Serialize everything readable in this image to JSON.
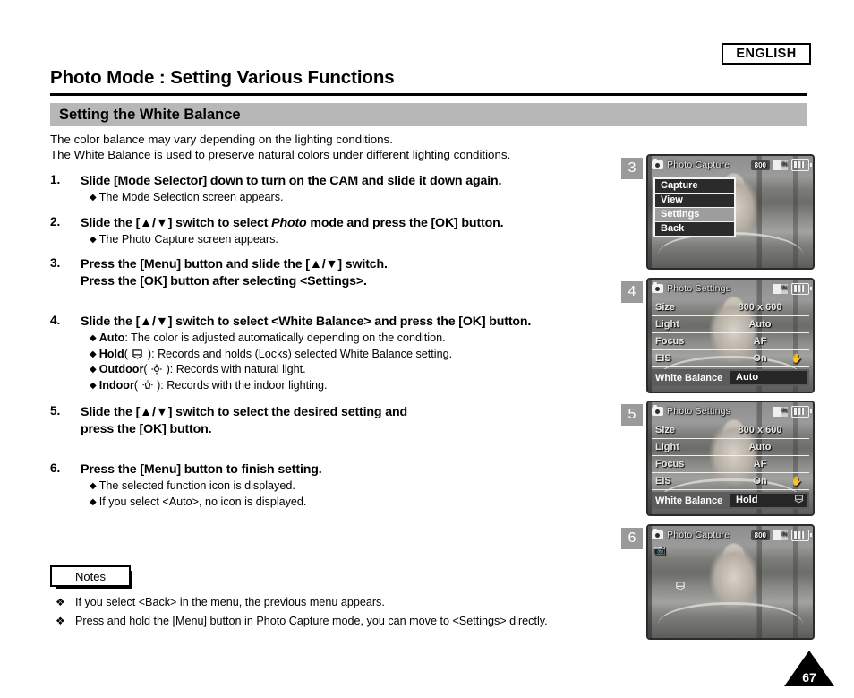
{
  "header": {
    "language_badge": "ENGLISH",
    "page_title": "Photo Mode : Setting Various Functions",
    "section_title": "Setting the White Balance"
  },
  "intro": {
    "line1": "The color balance may vary depending on the lighting conditions.",
    "line2": "The White Balance is used to preserve natural colors under different lighting conditions."
  },
  "steps": [
    {
      "num": "1.",
      "head": "Slide [Mode Selector] down to turn on the CAM and slide it down again.",
      "subs": [
        "The Mode Selection screen appears."
      ]
    },
    {
      "num": "2.",
      "head_pre": "Slide the [▲/▼] switch to select ",
      "head_ital": "Photo",
      "head_post": " mode and press the [OK] button.",
      "subs": [
        "The Photo Capture screen appears."
      ]
    },
    {
      "num": "3.",
      "head_line1": "Press the [Menu] button and slide the [▲/▼] switch.",
      "head_line2": "Press the [OK] button after selecting <Settings>."
    },
    {
      "num": "4.",
      "head": "Slide the [▲/▼] switch to select <White Balance> and press the [OK] button.",
      "options": [
        {
          "name": "Auto",
          "icon": "",
          "desc": ": The color is adjusted automatically depending on the condition."
        },
        {
          "name": "Hold",
          "icon": "hold-icon",
          "desc": "): Records and holds (Locks) selected White Balance setting."
        },
        {
          "name": "Outdoor",
          "icon": "sun-icon",
          "desc": "): Records with natural light."
        },
        {
          "name": "Indoor",
          "icon": "bulb-icon",
          "desc": "): Records with the indoor lighting."
        }
      ]
    },
    {
      "num": "5.",
      "head_line1": "Slide the [▲/▼] switch to select the desired setting and",
      "head_line2": "press the [OK] button."
    },
    {
      "num": "6.",
      "head": "Press the [Menu] button to finish setting.",
      "subs": [
        "The selected function icon is displayed.",
        "If you select <Auto>, no icon is displayed."
      ]
    }
  ],
  "notes": {
    "tab_label": "Notes",
    "items": [
      "If you select <Back> in the menu, the previous menu appears.",
      "Press and hold the [Menu] button in Photo Capture mode, you can move to <Settings> directly."
    ]
  },
  "screens": [
    {
      "badge": "3",
      "osd_title": "Photo Capture",
      "osd_resolution": "800",
      "menu_items": [
        {
          "label": "Capture",
          "selected": false
        },
        {
          "label": "View",
          "selected": false
        },
        {
          "label": "Settings",
          "selected": true
        },
        {
          "label": "Back",
          "selected": false
        }
      ]
    },
    {
      "badge": "4",
      "osd_title": "Photo Settings",
      "rows": [
        {
          "label": "Size",
          "value": "800 x 600"
        },
        {
          "label": "Light",
          "value": "Auto"
        },
        {
          "label": "Focus",
          "value": "AF"
        },
        {
          "label": "EIS",
          "value": "On"
        }
      ],
      "wb_label": "White Balance",
      "wb_value": "Auto",
      "wb_icon": ""
    },
    {
      "badge": "5",
      "osd_title": "Photo Settings",
      "rows": [
        {
          "label": "Size",
          "value": "800 x 600"
        },
        {
          "label": "Light",
          "value": "Auto"
        },
        {
          "label": "Focus",
          "value": "AF"
        },
        {
          "label": "EIS",
          "value": "On"
        }
      ],
      "wb_label": "White Balance",
      "wb_value": "Hold",
      "wb_icon": "hold-icon"
    },
    {
      "badge": "6",
      "osd_title": "Photo Capture",
      "osd_resolution": "800"
    }
  ],
  "footer": {
    "page_number": "67"
  },
  "colors": {
    "section_band": "#b7b7b7",
    "step_badge": "#9a9a9a",
    "menu_selected": "#9d9d9d",
    "menu_item": "#2b2b2b"
  }
}
